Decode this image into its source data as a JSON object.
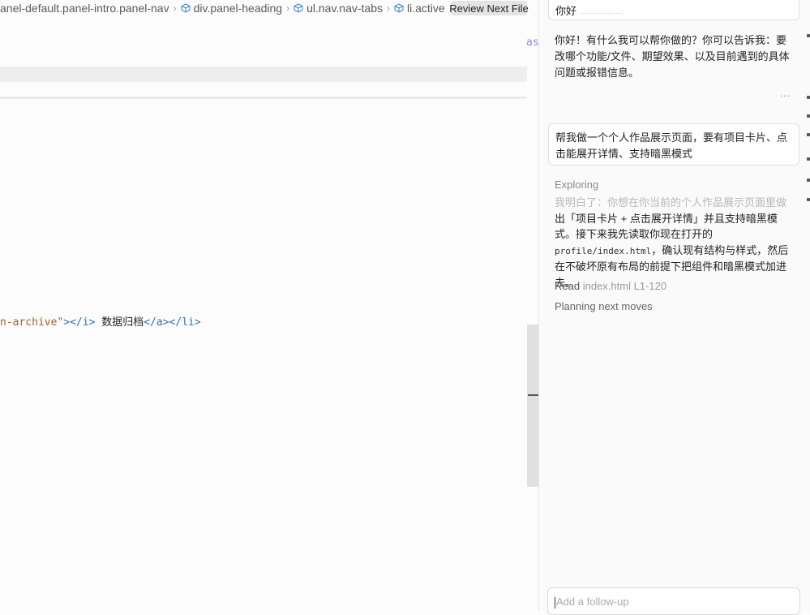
{
  "breadcrumb": {
    "items": [
      "anel-default.panel-intro.panel-nav",
      "div.panel-heading",
      "ul.nav.nav-tabs",
      "li.active"
    ],
    "review_label": "Review Next File"
  },
  "editor": {
    "trunc_right": "as",
    "code_line": {
      "tok1": "n-archive\"",
      "tok2": "></i> ",
      "tok3": "数据归档",
      "tok4": "</a></li>"
    }
  },
  "chat": {
    "top_user_message": "你好",
    "assistant_reply": "你好！有什么我可以帮你做的？你可以告诉我：要改哪个功能/文件、期望效果、以及目前遇到的具体问题或报错信息。",
    "reply_more": "...",
    "user_message": "帮我做一个个人作品展示页面，要有项目卡片、点击能展开详情、支持暗黑模式",
    "exploring_label": "Exploring",
    "exploring_faded": "我明白了：你想在你当前的个人作品展示页面里做",
    "exploring_text_a": "出「项目卡片 + 点击展开详情」并且支持暗黑模式。接下来我先读取你现在打开的 ",
    "exploring_code": "profile/index.html",
    "exploring_text_b": "，确认现有结构与样式，然后在不破坏原有布局的前提下把组件和暗黑模式加进去。",
    "read_prefix": "Read",
    "read_file": "index.html L1-120",
    "planning": "Planning next moves",
    "followup_placeholder": "Add a follow-up"
  }
}
